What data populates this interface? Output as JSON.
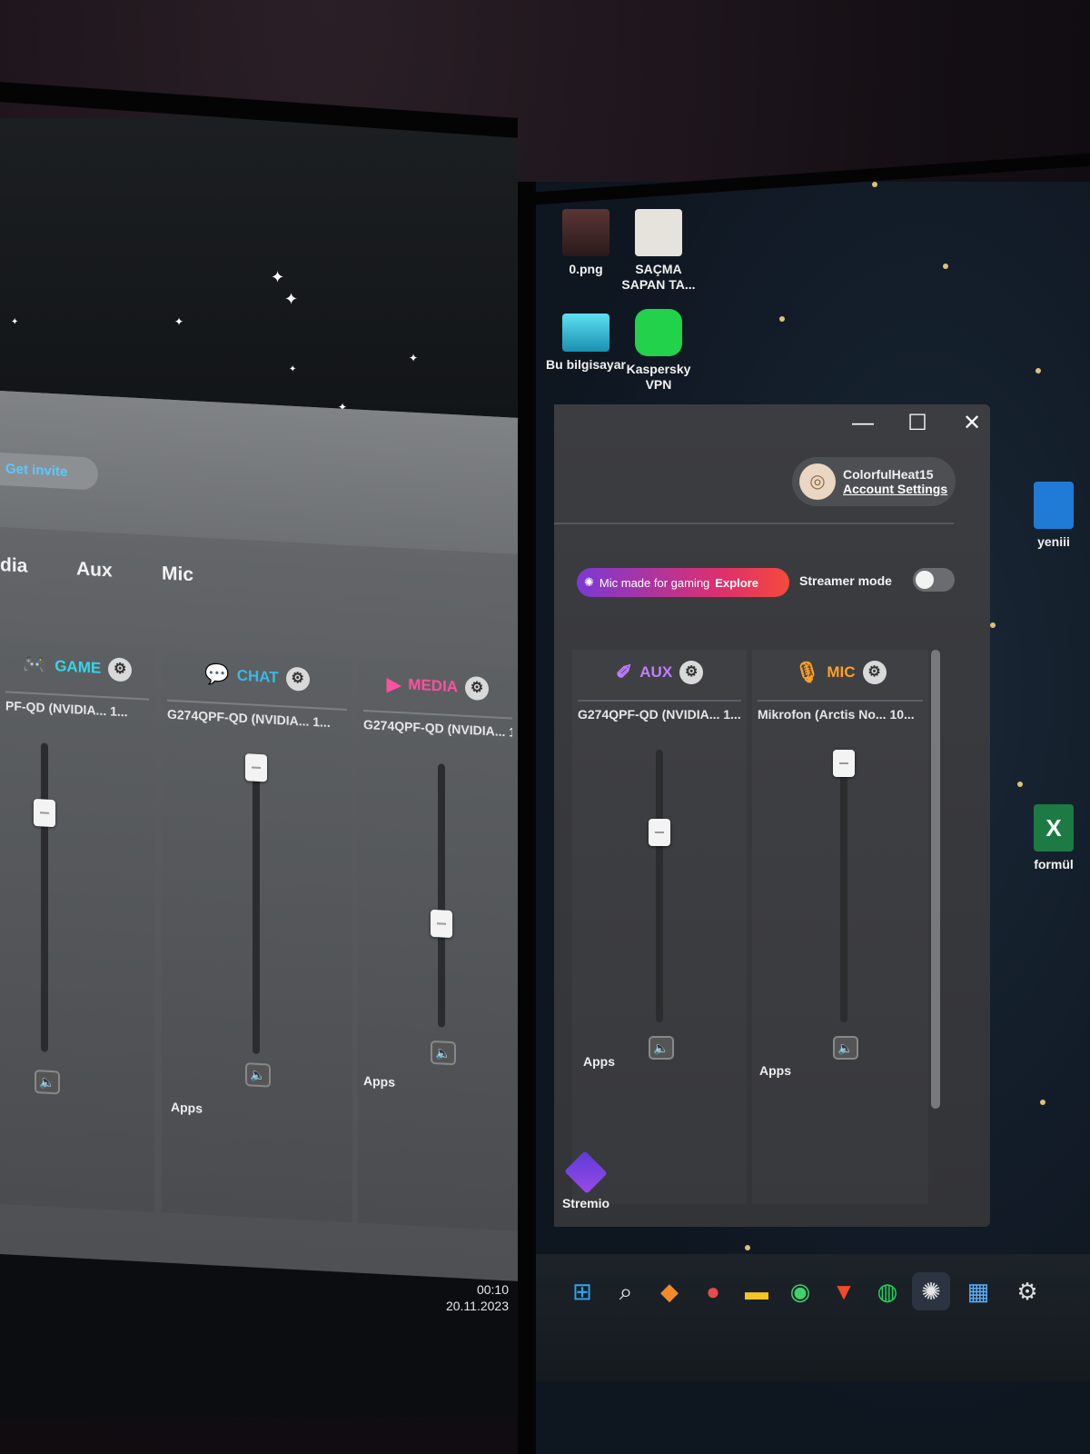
{
  "left_monitor": {
    "invite_label": "Get invite",
    "tabs": [
      "dia",
      "Aux",
      "Mic"
    ],
    "channels": [
      {
        "name": "GAME",
        "color": "#39d3e8",
        "device": "PF-QD (NVIDIA... 1...",
        "level": 0.8
      },
      {
        "name": "CHAT",
        "color": "#39b8e8",
        "device": "G274QPF-QD (NVIDIA... 1...",
        "level": 1.0
      },
      {
        "name": "MEDIA",
        "color": "#ff4fa0",
        "device": "G274QPF-QD (NVIDIA... 1...",
        "level": 0.38
      }
    ],
    "apps_label": "Apps",
    "clock_time": "00:10",
    "clock_date": "20.11.2023"
  },
  "desktop_icons": [
    {
      "label": "0.png",
      "icon": "image-file-icon"
    },
    {
      "label": "SAÇMA SAPAN TA...",
      "icon": "document-icon"
    },
    {
      "label": "Bu bilgisayar",
      "icon": "computer-icon"
    },
    {
      "label": "Kaspersky VPN",
      "icon": "kaspersky-vpn-icon"
    },
    {
      "label": "yeniii",
      "icon": "app-icon"
    },
    {
      "label": "formül",
      "icon": "excel-icon"
    },
    {
      "label": "Stremio",
      "icon": "stremio-icon"
    }
  ],
  "right_window": {
    "controls": [
      "—",
      "☐",
      "✕"
    ],
    "account_name": "ColorfulHeat15",
    "account_link": "Account Settings",
    "promo_text": "Mic made for gaming",
    "promo_cta": "Explore",
    "streamer_mode_label": "Streamer mode",
    "streamer_mode_on": false,
    "channels": [
      {
        "name": "AUX",
        "color": "#c27cff",
        "device": "G274QPF-QD (NVIDIA... 1...",
        "level": 0.72
      },
      {
        "name": "MIC",
        "color": "#ffa024",
        "device": "Mikrofon (Arctis No... 10...",
        "level": 1.0
      }
    ],
    "apps_label": "Apps"
  },
  "taskbar": [
    "start-icon",
    "search-icon",
    "copilot-icon",
    "chat-icon",
    "explorer-icon",
    "whatsapp-icon",
    "brave-icon",
    "spotify-icon",
    "steelseries-icon",
    "store-icon",
    "settings-icon"
  ]
}
